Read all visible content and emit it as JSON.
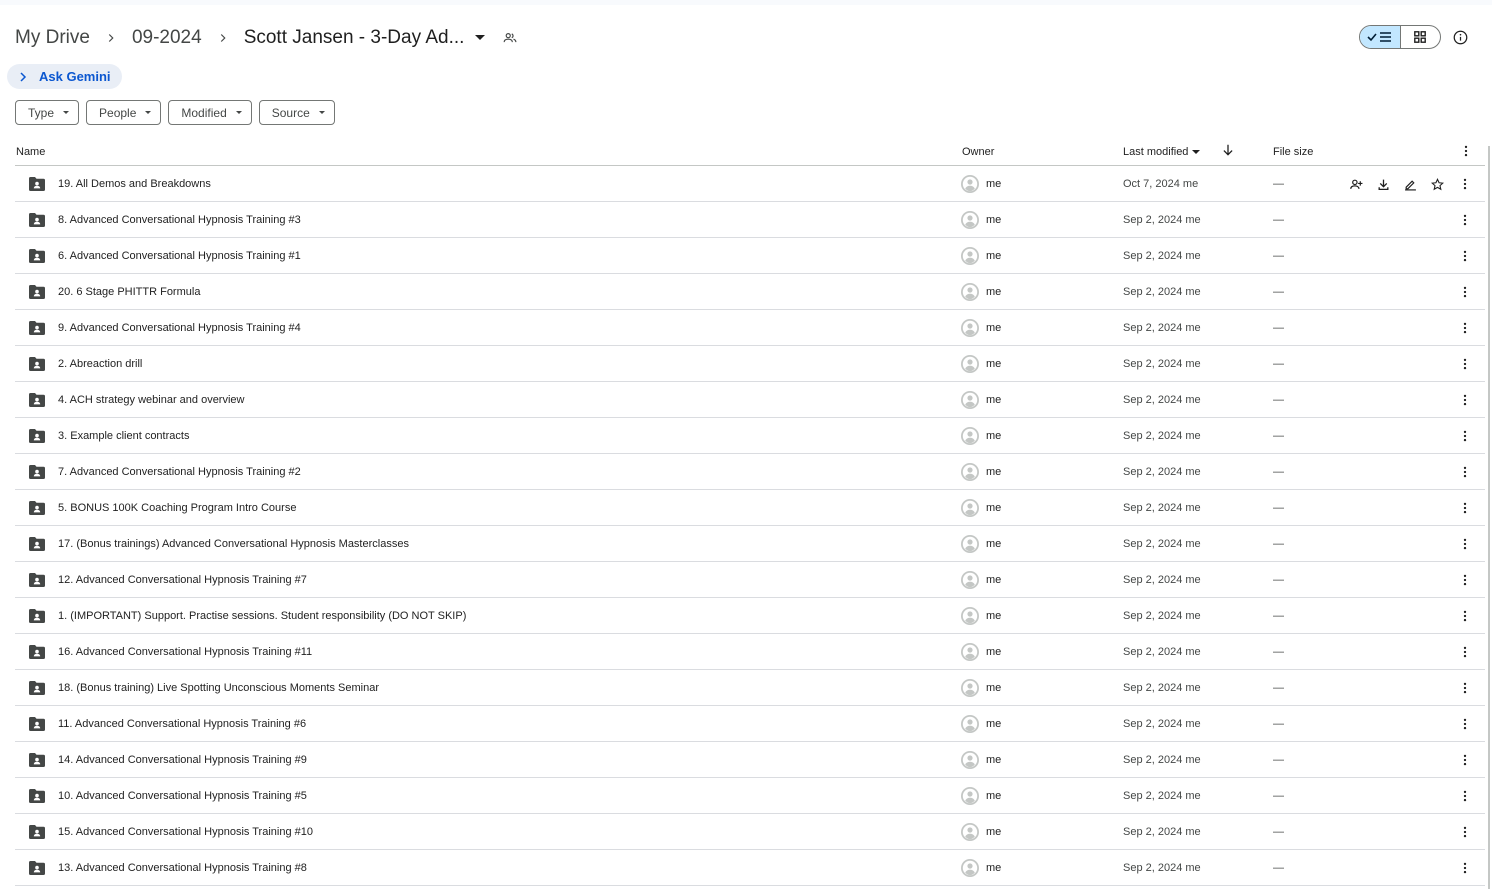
{
  "breadcrumb": {
    "items": [
      "My Drive",
      "09-2024",
      "Scott Jansen - 3-Day Ad..."
    ]
  },
  "gemini": {
    "label": "Ask Gemini"
  },
  "filters": [
    "Type",
    "People",
    "Modified",
    "Source"
  ],
  "columns": {
    "name": "Name",
    "owner": "Owner",
    "last_modified": "Last modified",
    "file_size": "File size"
  },
  "rows": [
    {
      "name": "19. All Demos and Breakdowns",
      "owner": "me",
      "modified": "Oct 7, 2024 me",
      "size": "—"
    },
    {
      "name": "8. Advanced Conversational Hypnosis Training #3",
      "owner": "me",
      "modified": "Sep 2, 2024 me",
      "size": "—"
    },
    {
      "name": "6. Advanced Conversational Hypnosis Training #1",
      "owner": "me",
      "modified": "Sep 2, 2024 me",
      "size": "—"
    },
    {
      "name": "20. 6 Stage PHITTR Formula",
      "owner": "me",
      "modified": "Sep 2, 2024 me",
      "size": "—"
    },
    {
      "name": "9. Advanced Conversational Hypnosis Training #4",
      "owner": "me",
      "modified": "Sep 2, 2024 me",
      "size": "—"
    },
    {
      "name": "2. Abreaction drill",
      "owner": "me",
      "modified": "Sep 2, 2024 me",
      "size": "—"
    },
    {
      "name": "4. ACH strategy webinar and overview",
      "owner": "me",
      "modified": "Sep 2, 2024 me",
      "size": "—"
    },
    {
      "name": "3. Example client contracts",
      "owner": "me",
      "modified": "Sep 2, 2024 me",
      "size": "—"
    },
    {
      "name": "7. Advanced Conversational Hypnosis Training #2",
      "owner": "me",
      "modified": "Sep 2, 2024 me",
      "size": "—"
    },
    {
      "name": "5. BONUS 100K Coaching Program Intro Course",
      "owner": "me",
      "modified": "Sep 2, 2024 me",
      "size": "—"
    },
    {
      "name": "17. (Bonus trainings) Advanced Conversational Hypnosis Masterclasses",
      "owner": "me",
      "modified": "Sep 2, 2024 me",
      "size": "—"
    },
    {
      "name": "12. Advanced Conversational Hypnosis Training #7",
      "owner": "me",
      "modified": "Sep 2, 2024 me",
      "size": "—"
    },
    {
      "name": "1. (IMPORTANT) Support. Practise sessions. Student responsibility (DO NOT SKIP)",
      "owner": "me",
      "modified": "Sep 2, 2024 me",
      "size": "—"
    },
    {
      "name": "16. Advanced Conversational Hypnosis Training #11",
      "owner": "me",
      "modified": "Sep 2, 2024 me",
      "size": "—"
    },
    {
      "name": "18. (Bonus training) Live Spotting Unconscious Moments Seminar",
      "owner": "me",
      "modified": "Sep 2, 2024 me",
      "size": "—"
    },
    {
      "name": "11. Advanced Conversational Hypnosis Training #6",
      "owner": "me",
      "modified": "Sep 2, 2024 me",
      "size": "—"
    },
    {
      "name": "14. Advanced Conversational Hypnosis Training #9",
      "owner": "me",
      "modified": "Sep 2, 2024 me",
      "size": "—"
    },
    {
      "name": "10. Advanced Conversational Hypnosis Training #5",
      "owner": "me",
      "modified": "Sep 2, 2024 me",
      "size": "—"
    },
    {
      "name": "15. Advanced Conversational Hypnosis Training #10",
      "owner": "me",
      "modified": "Sep 2, 2024 me",
      "size": "—"
    },
    {
      "name": "13. Advanced Conversational Hypnosis Training #8",
      "owner": "me",
      "modified": "Sep 2, 2024 me",
      "size": "—"
    }
  ],
  "row_actions": [
    "share-icon",
    "download-icon",
    "rename-icon",
    "star-icon"
  ],
  "colors": {
    "accent": "#0b57d0",
    "toggle_selected": "#c2e7ff",
    "icon": "#444746"
  }
}
